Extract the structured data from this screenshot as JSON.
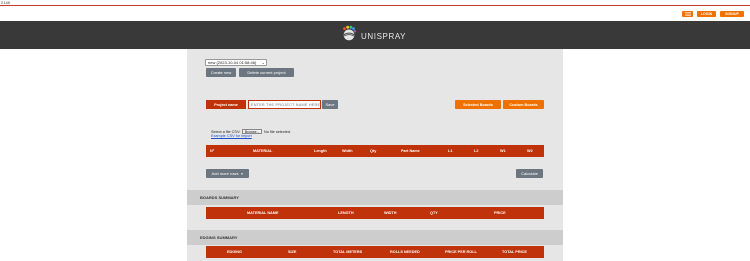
{
  "top": {
    "code": "2148"
  },
  "topbar": {
    "buttons": {
      "icon": "menu-icon",
      "login": "LOGIN",
      "signup": "SIGNUP"
    }
  },
  "header": {
    "logo_text": "UNISPRAY"
  },
  "project": {
    "select_value": "new (2023-10-04 01:58:46)",
    "create_label": "Create new",
    "delete_label": "Delete current project",
    "name_label": "Project name",
    "name_placeholder": "ENTER THE PROJECT NAME HERE",
    "save_label": "Save",
    "selected_boards_label": "Selected Boards",
    "custom_boards_label": "Custom Boards"
  },
  "csv": {
    "label": "Select a file CSV:",
    "browse_label": "Browse...",
    "status": "No file selected.",
    "example_link": "Example CSV for import"
  },
  "items_table": {
    "columns": [
      "N°",
      "MATERIAL",
      "Length",
      "Width",
      "Qty",
      "Part Name",
      "L1",
      "L2",
      "W1",
      "W2"
    ]
  },
  "actions": {
    "add_rows_label": "Add more rows",
    "calculate_label": "Calculate"
  },
  "boards_summary": {
    "title": "BOARDS SUMMARY",
    "columns": [
      "MATERIAL NAME",
      "LENGTH",
      "WIDTH",
      "QTY",
      "PRICE"
    ]
  },
  "edging_summary": {
    "title": "EDGING SUMMARY",
    "columns": [
      "EDGING",
      "SIZE",
      "TOTAL METERS",
      "ROLLS NEEDED",
      "PRICE PER ROLL",
      "TOTAL PRICE"
    ]
  },
  "colors": {
    "accent_orange": "#f07000",
    "table_red": "#c0320a",
    "header_dark": "#393939",
    "panel_gray": "#e6e6e6"
  }
}
